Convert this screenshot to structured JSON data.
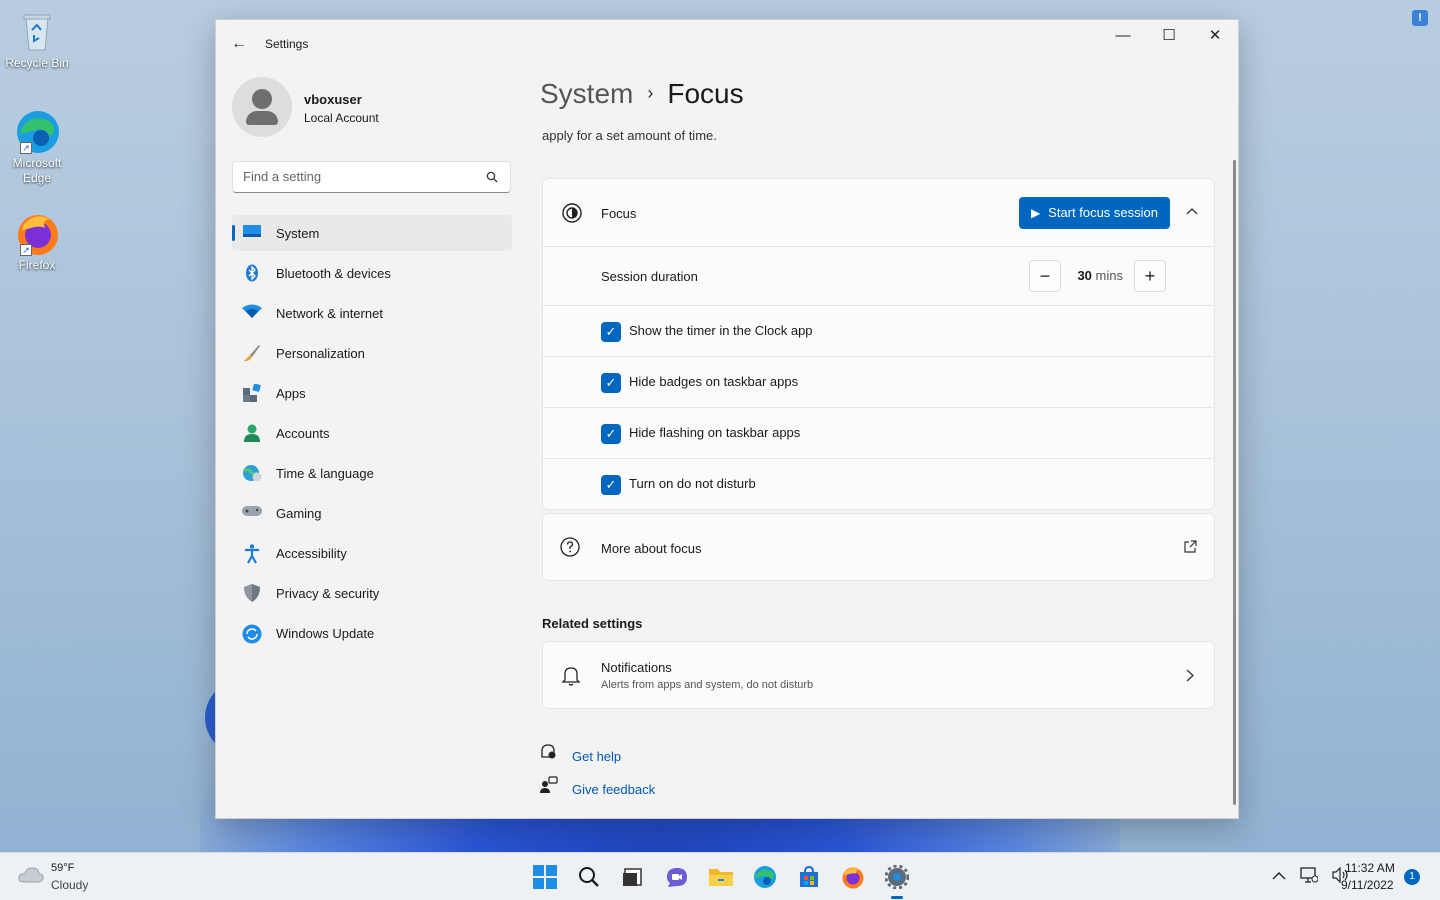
{
  "desktop": {
    "icons": [
      {
        "label": "Recycle Bin"
      },
      {
        "label": "Microsoft Edge"
      },
      {
        "label": "Firefox"
      }
    ]
  },
  "window": {
    "title": "Settings",
    "controls": {
      "minimize": "—",
      "maximize": "☐",
      "close": "✕"
    }
  },
  "user": {
    "name": "vboxuser",
    "account_type": "Local Account"
  },
  "search": {
    "placeholder": "Find a setting"
  },
  "sidebar": {
    "items": [
      {
        "label": "System",
        "icon": "monitor-icon",
        "active": true
      },
      {
        "label": "Bluetooth & devices",
        "icon": "bluetooth-icon"
      },
      {
        "label": "Network & internet",
        "icon": "wifi-icon"
      },
      {
        "label": "Personalization",
        "icon": "brush-icon"
      },
      {
        "label": "Apps",
        "icon": "apps-icon"
      },
      {
        "label": "Accounts",
        "icon": "person-icon"
      },
      {
        "label": "Time & language",
        "icon": "globe-clock-icon"
      },
      {
        "label": "Gaming",
        "icon": "gamepad-icon"
      },
      {
        "label": "Accessibility",
        "icon": "accessibility-icon"
      },
      {
        "label": "Privacy & security",
        "icon": "shield-icon"
      },
      {
        "label": "Windows Update",
        "icon": "update-icon"
      }
    ]
  },
  "breadcrumb": {
    "parent": "System",
    "separator": "›",
    "current": "Focus"
  },
  "description": "apply for a set amount of time.",
  "focus_card": {
    "title": "Focus",
    "start_button": "Start focus session",
    "session_duration_label": "Session duration",
    "duration_value": "30",
    "duration_unit": "mins",
    "decrease": "−",
    "increase": "+",
    "options": [
      {
        "label": "Show the timer in the Clock app",
        "checked": true
      },
      {
        "label": "Hide badges on taskbar apps",
        "checked": true
      },
      {
        "label": "Hide flashing on taskbar apps",
        "checked": true
      },
      {
        "label": "Turn on do not disturb",
        "checked": true
      }
    ]
  },
  "more_about": {
    "label": "More about focus"
  },
  "related": {
    "title": "Related settings",
    "notifications": {
      "title": "Notifications",
      "subtitle": "Alerts from apps and system, do not disturb"
    }
  },
  "help_links": {
    "get_help": "Get help",
    "give_feedback": "Give feedback"
  },
  "taskbar": {
    "weather": {
      "temp": "59°F",
      "condition": "Cloudy"
    },
    "clock": {
      "time": "11:32 AM",
      "date": "9/11/2022"
    },
    "notification_count": "1"
  },
  "colors": {
    "accent": "#0067c0"
  }
}
